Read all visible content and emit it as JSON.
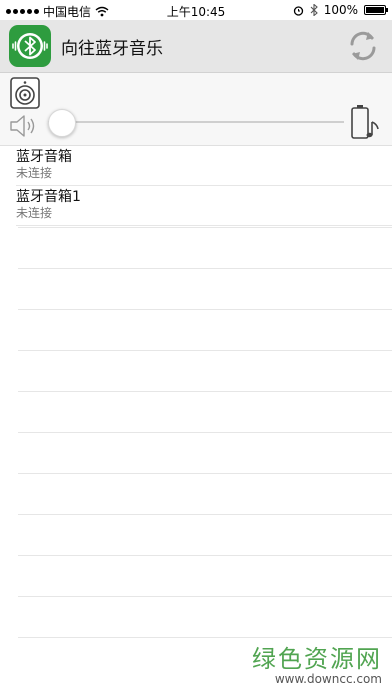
{
  "status_bar": {
    "carrier": "中国电信",
    "time": "上午10:45",
    "battery_percent": "100%"
  },
  "header": {
    "title": "向往蓝牙音乐",
    "refresh_icon": "refresh-icon",
    "logo_icon": "bluetooth-music-logo"
  },
  "controls": {
    "volume_level": 0,
    "speaker_icon": "speaker-icon",
    "volume_icon": "volume-icon",
    "battery_icon": "battery-music-icon"
  },
  "devices": [
    {
      "name": "蓝牙音箱",
      "status": "未连接"
    },
    {
      "name": "蓝牙音箱1",
      "status": "未连接"
    }
  ],
  "watermark": {
    "main": "绿色资源网",
    "sub": "www.downcc.com"
  },
  "colors": {
    "header_bg": "#e6e6e6",
    "logo_green": "#2e9c3f",
    "watermark_green": "#3f9b3f"
  }
}
